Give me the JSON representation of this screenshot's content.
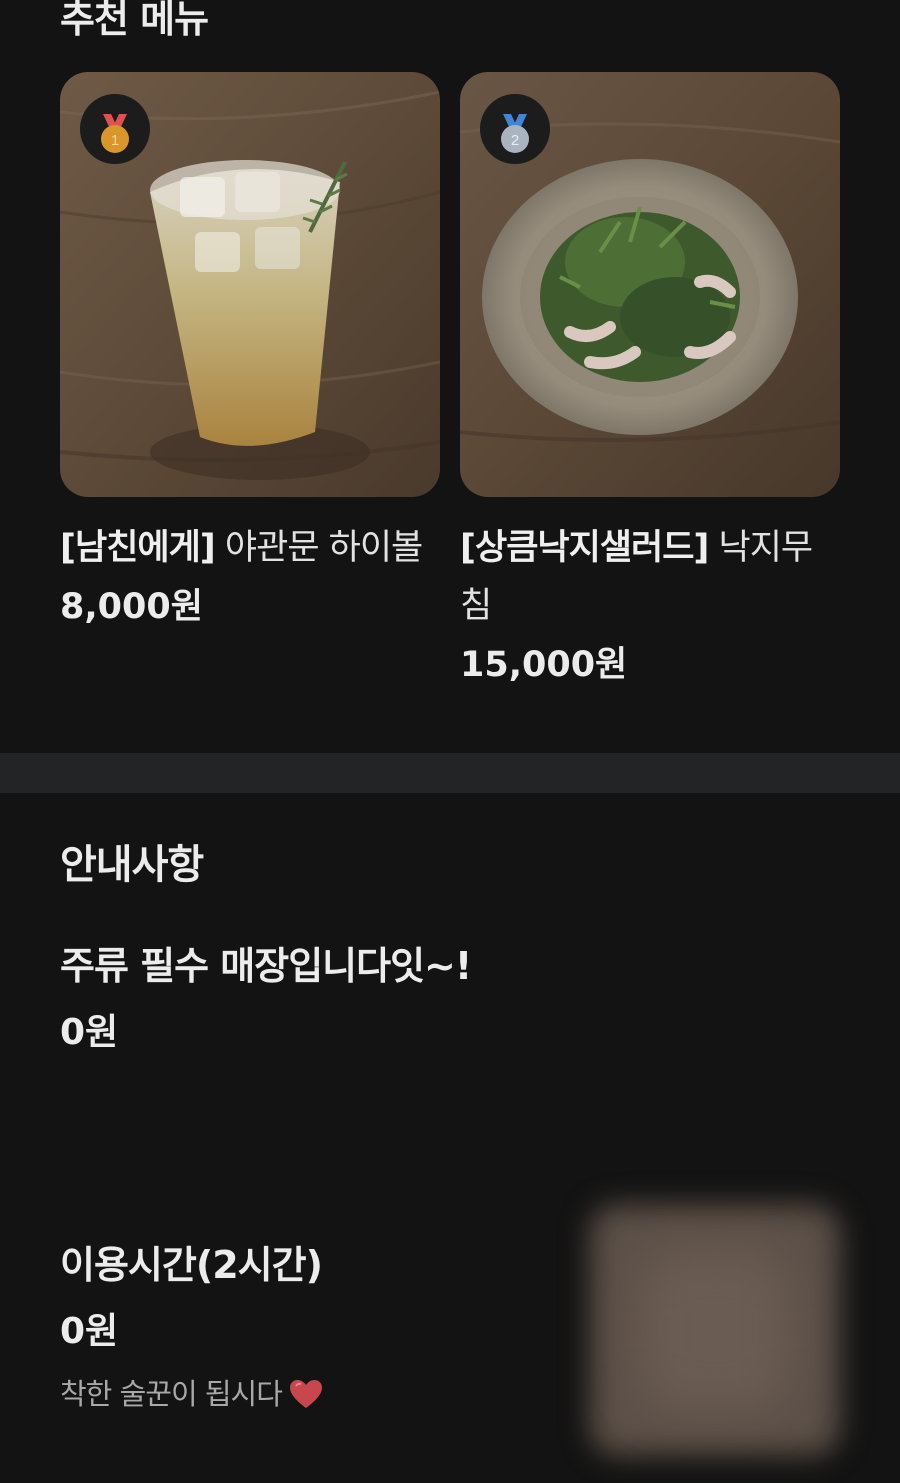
{
  "recommended": {
    "title": "추천 메뉴",
    "items": [
      {
        "rank": "1",
        "tag": "[남친에게]",
        "name": " 야관문 하이볼",
        "price": "8,000원",
        "image_icon": "highball-glass-photo",
        "medal_color": "#d9962b",
        "ribbon_color": "#e0524f"
      },
      {
        "rank": "2",
        "tag": "[상큼낙지샐러드]",
        "name": " 낙지무침",
        "price": "15,000원",
        "image_icon": "octopus-salad-photo",
        "medal_color": "#a9b4c0",
        "ribbon_color": "#3f86d8"
      }
    ]
  },
  "notice": {
    "title": "안내사항",
    "items": [
      {
        "name": "주류 필수 매장입니다잇~!",
        "price": "0원"
      },
      {
        "name": "이용시간(2시간)",
        "price": "0원",
        "description": "착한 술꾼이 됩시다",
        "description_icon": "heart-icon"
      }
    ]
  },
  "colors": {
    "background": "#131313",
    "divider": "#232425",
    "text": "#ececec",
    "subtext": "#a8a8a8",
    "heart": "#c8474f"
  }
}
